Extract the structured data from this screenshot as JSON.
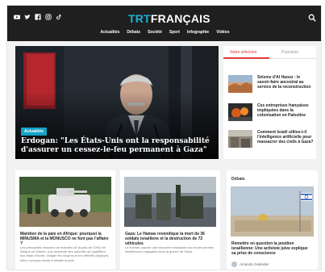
{
  "brand": {
    "logo_prefix": "TRT",
    "logo_suffix": "FRANÇAIS",
    "accent": "#14a3c7",
    "red": "#e03a3a"
  },
  "social_icons": [
    "youtube-icon",
    "twitter-icon",
    "facebook-icon",
    "instagram-icon",
    "tiktok-icon"
  ],
  "nav": {
    "items": [
      "Actualités",
      "Débats",
      "Société",
      "Sport",
      "Infographie",
      "Vidéos"
    ]
  },
  "hero": {
    "badge": "Actualités",
    "headline": "Erdogan: \"Les États-Unis ont la responsabilité d'assurer un cessez-le-feu permanent à Gaza\""
  },
  "side": {
    "tabs": [
      "Notre sélection",
      "Populaire"
    ],
    "items": [
      {
        "title": "Séisme d'Al Haouz : le savoir-faire ancestral au service de la reconstruction"
      },
      {
        "title": "Ces entreprises françaises impliquées dans la colonisation en Palestine"
      },
      {
        "title": "Comment Israël utilise-t-il l'intelligence artificielle pour massacrer des civils à Gaza?"
      }
    ]
  },
  "cards": [
    {
      "title": "Maintien de la paix en Afrique: pourquoi la MINUSMA et la MONUSCO ne font pas l'affaire ?",
      "desc": "Les principales missions de maintien de la paix de l'ONU en Afrique se retirent, à la demande des autorités qui qualifient leur bilan d'échec. Malgré les moyens et les effectifs déployés, elles n'ont pas réussi à rétablir la paix."
    },
    {
      "title": "Gaza: Le Hamas revendique la mort de 36 soldats israéliens et la destruction de 72 véhicules",
      "desc": "Le Hamas oppose une farouche résistance aux forces armées israéliennes engagées dans la guerre de Gaza."
    },
    {
      "section": "Débats",
      "title": "Remettre en question la position israélienne: Une activiste juive explique sa prise de conscience",
      "author": "Amanda Gelender"
    }
  ]
}
